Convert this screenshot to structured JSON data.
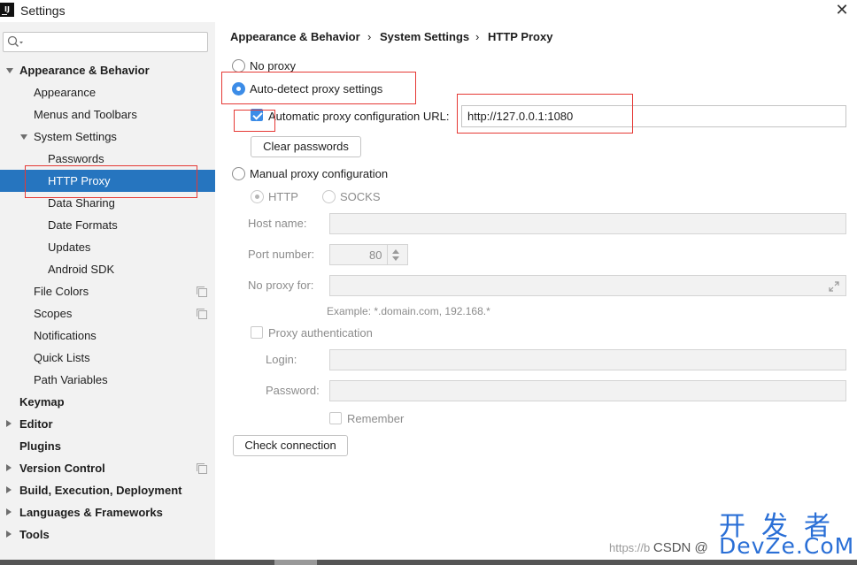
{
  "window": {
    "title": "Settings",
    "logo_text": "IJ"
  },
  "sidebar": {
    "search_placeholder": "",
    "items": [
      {
        "label": "Appearance & Behavior",
        "level": 0,
        "bold": true,
        "expanded": true
      },
      {
        "label": "Appearance",
        "level": 1
      },
      {
        "label": "Menus and Toolbars",
        "level": 1
      },
      {
        "label": "System Settings",
        "level": 1,
        "expanded": true
      },
      {
        "label": "Passwords",
        "level": 2
      },
      {
        "label": "HTTP Proxy",
        "level": 2,
        "selected": true
      },
      {
        "label": "Data Sharing",
        "level": 2
      },
      {
        "label": "Date Formats",
        "level": 2
      },
      {
        "label": "Updates",
        "level": 2
      },
      {
        "label": "Android SDK",
        "level": 2
      },
      {
        "label": "File Colors",
        "level": 1,
        "copy_icon": true
      },
      {
        "label": "Scopes",
        "level": 1,
        "copy_icon": true
      },
      {
        "label": "Notifications",
        "level": 1
      },
      {
        "label": "Quick Lists",
        "level": 1
      },
      {
        "label": "Path Variables",
        "level": 1
      },
      {
        "label": "Keymap",
        "level": 0,
        "bold": true
      },
      {
        "label": "Editor",
        "level": 0,
        "bold": true,
        "collapsed": true
      },
      {
        "label": "Plugins",
        "level": 0,
        "bold": true
      },
      {
        "label": "Version Control",
        "level": 0,
        "bold": true,
        "collapsed": true,
        "copy_icon": true
      },
      {
        "label": "Build, Execution, Deployment",
        "level": 0,
        "bold": true,
        "collapsed": true
      },
      {
        "label": "Languages & Frameworks",
        "level": 0,
        "bold": true,
        "collapsed": true
      },
      {
        "label": "Tools",
        "level": 0,
        "bold": true,
        "collapsed": true
      }
    ]
  },
  "breadcrumb": {
    "items": [
      "Appearance & Behavior",
      "System Settings",
      "HTTP Proxy"
    ],
    "separator": "›"
  },
  "proxy": {
    "no_proxy_label": "No proxy",
    "auto_detect_label": "Auto-detect proxy settings",
    "auto_config_url_label": "Automatic proxy configuration URL:",
    "auto_config_url_value": "http://127.0.0.1:1080",
    "clear_passwords_label": "Clear passwords",
    "manual_label": "Manual proxy configuration",
    "http_label": "HTTP",
    "socks_label": "SOCKS",
    "host_name_label": "Host name:",
    "host_name_value": "",
    "port_number_label": "Port number:",
    "port_number_value": "80",
    "no_proxy_for_label": "No proxy for:",
    "no_proxy_for_value": "",
    "example_text": "Example: *.domain.com, 192.168.*",
    "proxy_auth_label": "Proxy authentication",
    "login_label": "Login:",
    "password_label": "Password:",
    "remember_label": "Remember",
    "check_connection_label": "Check connection",
    "selected_mode": "auto-detect",
    "auto_config_url_checked": true
  },
  "watermark": {
    "cn_text": "开发者",
    "brand_text": "DevZe.CoM",
    "csdn_text": "CSDN @",
    "url_text": "https://b"
  },
  "colors": {
    "selection": "#2675bf",
    "accent": "#3c8ce7",
    "highlight_box": "#e53935",
    "watermark": "#2a6fd6"
  }
}
